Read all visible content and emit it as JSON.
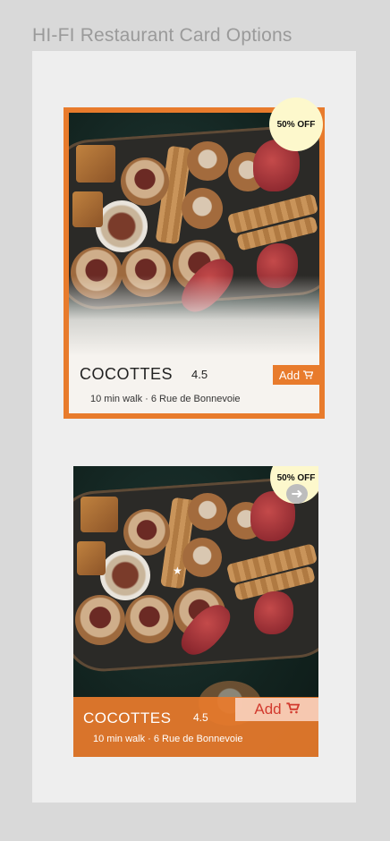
{
  "page": {
    "title": "HI-FI Restaurant Card Options"
  },
  "cards": [
    {
      "badge": "50% OFF",
      "name": "COCOTTES",
      "rating": "4.5",
      "add_label": "Add",
      "subtitle": "10 min walk · 6 Rue de Bonnevoie",
      "cart_icon": "cart-icon"
    },
    {
      "badge": "50% OFF",
      "name": "COCOTTES",
      "rating": "4.5",
      "add_label": "Add",
      "subtitle": "10 min walk · 6 Rue de Bonnevoie",
      "cart_icon": "cart-icon",
      "arrow_icon": "arrow-right-icon",
      "star_icon": "star-icon"
    }
  ],
  "colors": {
    "accent": "#e87b2c",
    "badge": "#fdf8cc",
    "add_text_v2": "#d23a2e"
  }
}
